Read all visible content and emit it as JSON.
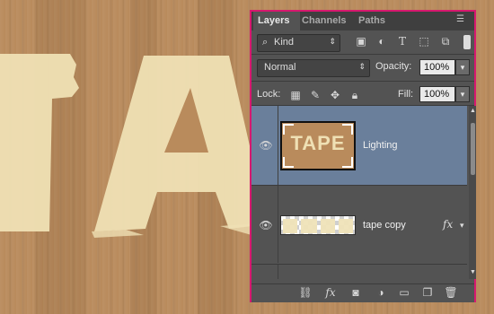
{
  "canvas": {
    "letters_color": "#efe0b4",
    "cardboard_color": "#b98b5c"
  },
  "panel": {
    "tabs": [
      {
        "label": "Layers",
        "active": true
      },
      {
        "label": "Channels",
        "active": false
      },
      {
        "label": "Paths",
        "active": false
      }
    ],
    "menu_icon": "panel-menu-icon",
    "filter": {
      "kind_label": "Kind",
      "icons": [
        "image-filter-icon",
        "adjustment-filter-icon",
        "type-filter-icon",
        "shape-filter-icon",
        "smart-object-filter-icon"
      ]
    },
    "blend_mode": "Normal",
    "opacity_label": "Opacity:",
    "opacity_value": "100%",
    "lock_label": "Lock:",
    "fill_label": "Fill:",
    "fill_value": "100%",
    "lock_icons": [
      "lock-transparent-icon",
      "lock-image-icon",
      "lock-position-icon",
      "lock-all-icon"
    ],
    "layers": [
      {
        "name": "Lighting",
        "selected": true,
        "thumbnail_text": "TAPE",
        "has_fx": false
      },
      {
        "name": "tape copy",
        "selected": false,
        "has_fx": true,
        "fx_label": "fx"
      }
    ],
    "footer_icons": [
      "link-layers-icon",
      "add-style-icon",
      "add-mask-icon",
      "adjustment-layer-icon",
      "group-icon",
      "new-layer-icon",
      "delete-icon"
    ],
    "accent": "#d7186f",
    "selection_color": "#6a7f9b"
  }
}
